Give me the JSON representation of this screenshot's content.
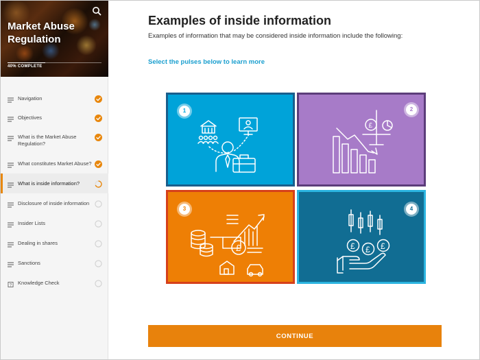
{
  "course": {
    "title": "Market Abuse Regulation",
    "progress_label": "40% COMPLETE",
    "progress_fraction": 0.4,
    "search_icon": "search-icon"
  },
  "sidebar": {
    "items": [
      {
        "label": "Navigation",
        "icon": "list-icon",
        "status": "complete"
      },
      {
        "label": "Objectives",
        "icon": "list-icon",
        "status": "complete"
      },
      {
        "label": "What is the Market Abuse Regulation?",
        "icon": "list-icon",
        "status": "complete"
      },
      {
        "label": "What constitutes Market Abuse?",
        "icon": "list-icon",
        "status": "complete"
      },
      {
        "label": "What is inside information?",
        "icon": "list-icon",
        "status": "in-progress"
      },
      {
        "label": "Disclosure of inside information",
        "icon": "list-icon",
        "status": "not-started"
      },
      {
        "label": "Insider Lists",
        "icon": "list-icon",
        "status": "not-started"
      },
      {
        "label": "Dealing in shares",
        "icon": "list-icon",
        "status": "not-started"
      },
      {
        "label": "Sanctions",
        "icon": "list-icon",
        "status": "not-started"
      },
      {
        "label": "Knowledge Check",
        "icon": "question-box-icon",
        "status": "not-started"
      }
    ]
  },
  "main": {
    "title": "Examples of inside information",
    "intro": "Examples of information that may be considered inside information include the following:",
    "prompt": "Select the pulses below to learn more",
    "tiles": [
      {
        "number": "1",
        "icon": "businessman-network-icon",
        "color": "#00a3d9",
        "border": "#1a5e8c"
      },
      {
        "number": "2",
        "icon": "declining-chart-pound-icon",
        "color": "#a77bc8",
        "border": "#5c3d7a"
      },
      {
        "number": "3",
        "icon": "money-property-growth-icon",
        "color": "#ee7f05",
        "border": "#d6401b"
      },
      {
        "number": "4",
        "icon": "candlestick-pounds-hand-icon",
        "color": "#116d93",
        "border": "#2bb4e0"
      }
    ],
    "continue_label": "CONTINUE"
  },
  "colors": {
    "accent": "#e8820c",
    "link": "#1a9fcf",
    "check": "#e8870d"
  }
}
